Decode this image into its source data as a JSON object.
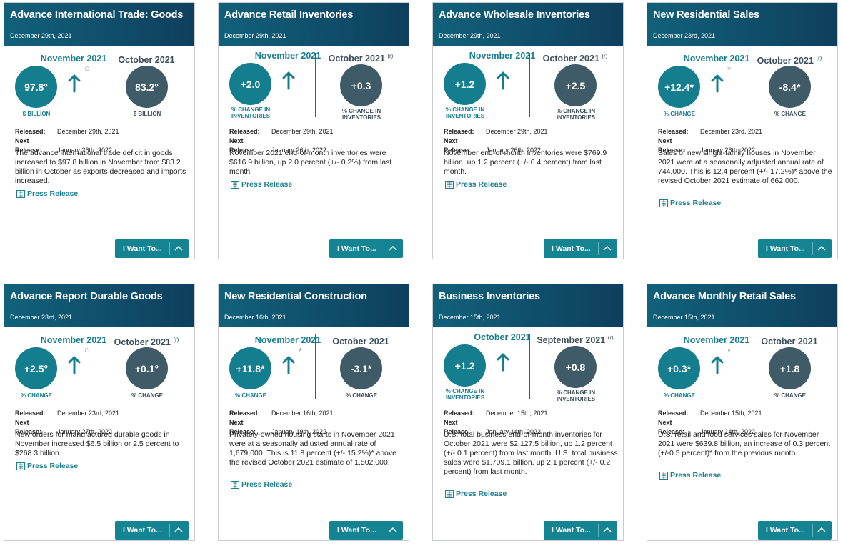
{
  "colors": {
    "header": "#0e3f5e",
    "accent": "#157e8e",
    "previous_circle": "#3f5b68",
    "button": "#148493"
  },
  "cards": [
    {
      "title": "Advance International Trade: Goods",
      "date": "December 29th, 2021",
      "current_period": "November 2021",
      "current_value": "97.8°",
      "current_unit": "$ BILLION",
      "marker": "○",
      "previous_period": "October 2021",
      "previous_note": "",
      "previous_value": "83.2°",
      "previous_unit": "$ BILLION",
      "released_label": "Released:",
      "released": "December 29th, 2021",
      "next_label": "Next Release:",
      "next": "January 26th, 2022",
      "summary": "The advance international trade deficit in goods increased to $97.8 billion in November from $83.2 billion in October as exports decreased and imports increased.",
      "press": "Press Release",
      "button": "I Want To..."
    },
    {
      "title": "Advance Retail Inventories",
      "date": "December 29th, 2021",
      "current_period": "November 2021",
      "current_value": "+2.0",
      "current_unit": "% CHANGE IN INVENTORIES",
      "marker": "",
      "previous_period": "October 2021",
      "previous_note": "(r)",
      "previous_value": "+0.3",
      "previous_unit": "% CHANGE IN INVENTORIES",
      "released_label": "Released:",
      "released": "December 29th, 2021",
      "next_label": "Next Release:",
      "next": "January 26th, 2022",
      "summary": "November 2021 end-of-month inventories were $616.9 billion, up 2.0 percent (+/- 0.2%) from last month.",
      "press": "Press Release",
      "button": "I Want To..."
    },
    {
      "title": "Advance Wholesale Inventories",
      "date": "December 29th, 2021",
      "current_period": "November 2021",
      "current_value": "+1.2",
      "current_unit": "% CHANGE IN INVENTORIES",
      "marker": "",
      "previous_period": "October 2021",
      "previous_note": "(r)",
      "previous_value": "+2.5",
      "previous_unit": "% CHANGE IN INVENTORIES",
      "released_label": "Released:",
      "released": "December 29th, 2021",
      "next_label": "Next Release:",
      "next": "January 26th, 2022",
      "summary": "November end-of-month inventories were $769.9 billion, up 1.2 percent (+/- 0.4 percent) from last month.",
      "press": "Press Release",
      "button": "I Want To..."
    },
    {
      "title": "New Residential Sales",
      "date": "December 23rd, 2021",
      "current_period": "November 2021",
      "current_value": "+12.4*",
      "current_unit": "% CHANGE",
      "marker": "*",
      "previous_period": "October 2021",
      "previous_note": "(r)",
      "previous_value": "-8.4*",
      "previous_unit": "% CHANGE",
      "released_label": "Released:",
      "released": "December 23rd, 2021",
      "next_label": "Next Release:",
      "next": "January 26th, 2022",
      "summary": "Sales of new single-family houses in November 2021 were at a seasonally adjusted annual rate of 744,000. This is 12.4 percent (+/- 17.2%)* above the revised October 2021 estimate of 662,000.",
      "press": "Press Release",
      "button": "I Want To..."
    },
    {
      "title": "Advance Report Durable Goods",
      "date": "December 23rd, 2021",
      "current_period": "November 2021",
      "current_value": "+2.5°",
      "current_unit": "% CHANGE",
      "marker": "○",
      "previous_period": "October 2021",
      "previous_note": "(r)",
      "previous_value": "+0.1°",
      "previous_unit": "% CHANGE",
      "released_label": "Released:",
      "released": "December 23rd, 2021",
      "next_label": "Next Release:",
      "next": "January 27th, 2022",
      "summary": "New orders for manufactured durable goods in November increased $6.5 billion or 2.5 percent to $268.3 billion.",
      "press": "Press Release",
      "button": "I Want To..."
    },
    {
      "title": "New Residential Construction",
      "date": "December 16th, 2021",
      "current_period": "November 2021",
      "current_value": "+11.8*",
      "current_unit": "% CHANGE",
      "marker": "*",
      "previous_period": "October 2021",
      "previous_note": "",
      "previous_value": "-3.1*",
      "previous_unit": "% CHANGE",
      "released_label": "Released:",
      "released": "December 16th, 2021",
      "next_label": "Next Release:",
      "next": "January 19th, 2022",
      "summary": "Privately-owned housing starts in November 2021 were at a seasonally adjusted annual rate of 1,679,000. This is 11.8 percent (+/- 15.2%)* above the revised October 2021 estimate of 1,502,000.",
      "press": "Press Release",
      "button": "I Want To..."
    },
    {
      "title": "Business Inventories",
      "date": "December 15th, 2021",
      "current_period": "October 2021",
      "current_value": "+1.2",
      "current_unit": "% CHANGE IN INVENTORIES",
      "marker": "",
      "previous_period": "September 2021",
      "previous_note": "(r)",
      "previous_value": "+0.8",
      "previous_unit": "% CHANGE IN INVENTORIES",
      "released_label": "Released:",
      "released": "December 15th, 2021",
      "next_label": "Next Release:",
      "next": "January 14th, 2022",
      "summary": "U.S. total business end-of-month inventories for October 2021 were $2,127.5 billion, up 1.2 percent (+/- 0.1 percent) from last month. U.S. total business sales were $1,709.1 billion, up 2.1 percent (+/- 0.2 percent) from last month.",
      "press": "Press Release",
      "button": "I Want To..."
    },
    {
      "title": "Advance Monthly Retail Sales",
      "date": "December 15th, 2021",
      "current_period": "November 2021",
      "current_value": "+0.3*",
      "current_unit": "% CHANGE",
      "marker": "*",
      "previous_period": "October 2021",
      "previous_note": "",
      "previous_value": "+1.8",
      "previous_unit": "% CHANGE",
      "released_label": "Released:",
      "released": "December 15th, 2021",
      "next_label": "Next Release:",
      "next": "January 14th, 2022",
      "summary": "U.S. retail and food services sales for November 2021 were $639.8 billion, an increase of 0.3 percent (+/-0.5 percent)* from the previous month.",
      "press": "Press Release",
      "button": "I Want To..."
    }
  ]
}
